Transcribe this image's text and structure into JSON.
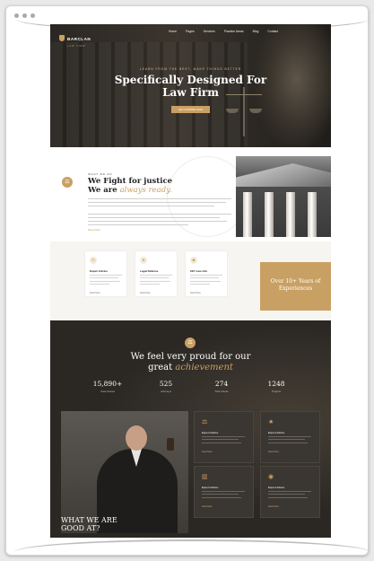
{
  "hero": {
    "logo": "BARCLAN",
    "logo_sub": "LAW FIRM",
    "nav": [
      "Home",
      "Pages",
      "Services",
      "Practice Areas",
      "Blog",
      "Contact"
    ],
    "kicker": "LEARN FROM THE BEST, MAKE THINGS BETTER",
    "title": "Specifically Designed For Law Firm",
    "button": "GET STARTED NOW"
  },
  "about": {
    "kicker": "WHAT WE DO",
    "title_line1": "We Fight for justice",
    "title_line2_prefix": "We are",
    "title_line2_accent": "always ready.",
    "link": "Read More"
  },
  "cards": [
    {
      "icon": "handshake-icon",
      "glyph": "⚖",
      "title": "Expert Advice",
      "more": "Read More"
    },
    {
      "icon": "star-icon",
      "glyph": "★",
      "title": "Legal Defense",
      "more": "Read More"
    },
    {
      "icon": "briefcase-icon",
      "glyph": "◆",
      "title": "24/7 care info",
      "more": "Read More"
    }
  ],
  "years_badge": "Over 10+ Years of Experiences",
  "achievement": {
    "title_line1": "We feel very proud for our",
    "title_line2_prefix": "great",
    "title_line2_accent": "achievement",
    "stats": [
      {
        "number": "15,890+",
        "label": "Case Solved"
      },
      {
        "number": "525",
        "label": "Attorneys"
      },
      {
        "number": "274",
        "label": "Total Clients"
      },
      {
        "number": "1248",
        "label": "Projects"
      }
    ],
    "what_we_are": "WHAT WE ARE GOOD AT?",
    "services": [
      {
        "icon": "scale-icon",
        "glyph": "⚖",
        "title": "Expert Advice",
        "more": "Read More"
      },
      {
        "icon": "star-icon",
        "glyph": "★",
        "title": "Expert Advice",
        "more": "Read More"
      },
      {
        "icon": "building-icon",
        "glyph": "▥",
        "title": "Expert Advice",
        "more": "Read More"
      },
      {
        "icon": "badge-icon",
        "glyph": "◉",
        "title": "Expert Advice",
        "more": "Read More"
      }
    ]
  },
  "colors": {
    "accent": "#c9a063",
    "dark": "#2b2824"
  }
}
